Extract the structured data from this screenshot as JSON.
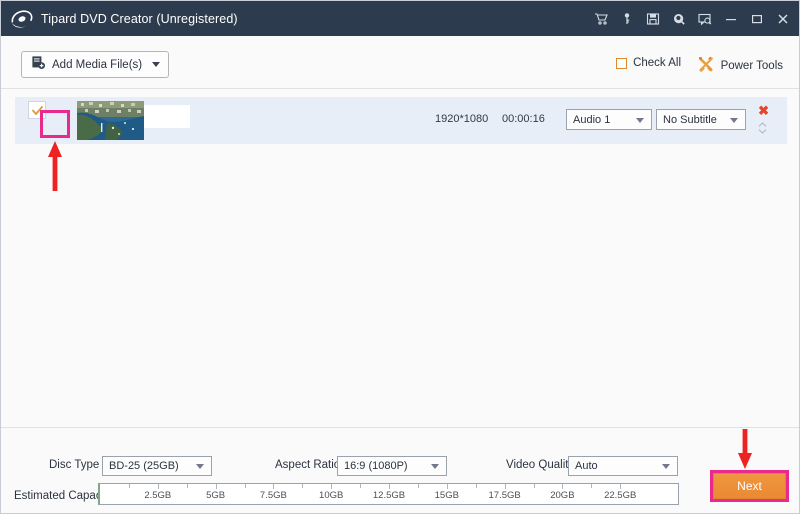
{
  "window": {
    "title": "Tipard DVD Creator (Unregistered)",
    "logo_icon": "tipard-disc-logo",
    "controls": [
      {
        "name": "cart-icon",
        "glyph": "cart"
      },
      {
        "name": "key-icon",
        "glyph": "key"
      },
      {
        "name": "save-icon",
        "glyph": "save"
      },
      {
        "name": "search-icon",
        "glyph": "search"
      },
      {
        "name": "feedback-icon",
        "glyph": "feedback"
      },
      {
        "name": "minimize-button",
        "glyph": "minimize"
      },
      {
        "name": "maximize-button",
        "glyph": "maximize"
      },
      {
        "name": "close-button",
        "glyph": "close"
      }
    ]
  },
  "toolbar": {
    "add_media_label": "Add Media File(s)",
    "add_media_icon": "add-file-icon",
    "check_all_label": "Check All",
    "check_all_checked": false,
    "power_tools_label": "Power Tools",
    "power_tools_icon": "tools-icon"
  },
  "media_list": {
    "rows": [
      {
        "checked": true,
        "filename": "",
        "resolution": "1920*1080",
        "duration": "00:00:16",
        "audio": "Audio 1",
        "subtitle": "No Subtitle",
        "remove_glyph": "✖"
      }
    ]
  },
  "settings": {
    "disc_type_label": "Disc Type",
    "disc_type_value": "BD-25 (25GB)",
    "aspect_ratio_label": "Aspect Ratio:",
    "aspect_ratio_value": "16:9 (1080P)",
    "video_quality_label": "Video Quality:",
    "video_quality_value": "Auto"
  },
  "capacity": {
    "label": "Estimated Capacity:",
    "ticks": [
      "2.5GB",
      "5GB",
      "7.5GB",
      "10GB",
      "12.5GB",
      "15GB",
      "17.5GB",
      "20GB",
      "22.5GB"
    ],
    "max_gb": 25,
    "used_gb": 0
  },
  "actions": {
    "next_label": "Next"
  },
  "annotations": {
    "arrow_color": "#ee2222",
    "highlight_color": "#e82a8e",
    "arrow_checkbox_direction": "up",
    "arrow_next_direction": "down"
  },
  "colors": {
    "titlebar": "#2c3b4d",
    "accent_orange": "#ea8a33",
    "row_background": "#e8eef7",
    "app_background": "#fafafa"
  }
}
